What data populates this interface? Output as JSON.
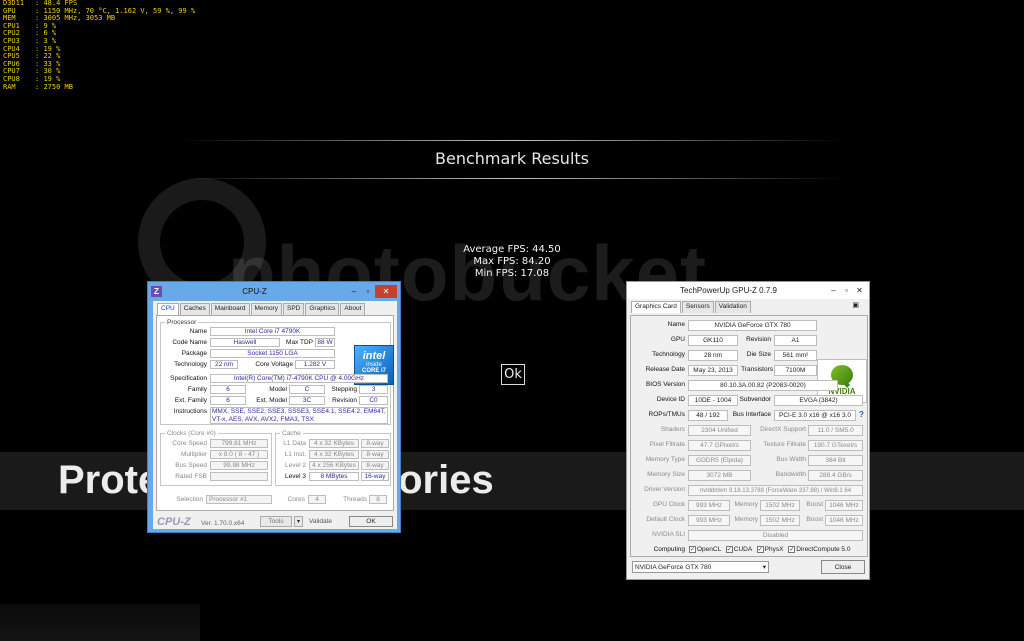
{
  "osd": {
    "lines": [
      {
        "k": "D3D11",
        "v": "48.4 FPS"
      },
      {
        "k": "GPU",
        "v": "1150 MHz, 70 °C, 1.162 V, 59 %, 99 %"
      },
      {
        "k": "MEM",
        "v": "3005 MHz, 3053 MB"
      },
      {
        "k": "CPU1",
        "v": "9 %"
      },
      {
        "k": "CPU2",
        "v": "6 %"
      },
      {
        "k": "CPU3",
        "v": "3 %"
      },
      {
        "k": "CPU4",
        "v": "19 %"
      },
      {
        "k": "CPU5",
        "v": "22 %"
      },
      {
        "k": "CPU6",
        "v": "33 %"
      },
      {
        "k": "CPU7",
        "v": "30 %"
      },
      {
        "k": "CPU8",
        "v": "19 %"
      },
      {
        "k": "RAM",
        "v": "2750 MB"
      }
    ],
    "color": "#f0d000"
  },
  "benchmark": {
    "title": "Benchmark Results",
    "average": "Average FPS: 44.50",
    "max": "Max FPS: 84.20",
    "min": "Min FPS: 17.08",
    "ok": "Ok"
  },
  "watermark": {
    "brand": "photobucket",
    "protect": "Protect your memories"
  },
  "cpuz": {
    "title": "CPU-Z",
    "tabs": [
      "CPU",
      "Caches",
      "Mainboard",
      "Memory",
      "SPD",
      "Graphics",
      "About"
    ],
    "processor_group": "Processor",
    "name_label": "Name",
    "name": "Intel Core i7 4790K",
    "codename_label": "Code Name",
    "codename": "Haswell",
    "maxtdp_label": "Max TDP",
    "maxtdp": "88 W",
    "package_label": "Package",
    "package": "Socket 1150 LGA",
    "technology_label": "Technology",
    "technology": "22 nm",
    "corevoltage_label": "Core Voltage",
    "corevoltage": "1.282 V",
    "spec_label": "Specification",
    "spec": "Intel(R) Core(TM) i7-4790K CPU @ 4.00GHz",
    "family_label": "Family",
    "family": "6",
    "model_label": "Model",
    "model": "C",
    "stepping_label": "Stepping",
    "stepping": "3",
    "extfamily_label": "Ext. Family",
    "extfamily": "6",
    "extmodel_label": "Ext. Model",
    "extmodel": "3C",
    "revision_label": "Revision",
    "revision": "C0",
    "instructions_label": "Instructions",
    "instructions": "MMX, SSE, SSE2, SSE3, SSSE3, SSE4.1, SSE4.2, EM64T, VT-x, AES, AVX, AVX2, FMA3, TSX",
    "intel_logo": {
      "brand": "intel",
      "inside": "inside",
      "core": "CORE i7"
    },
    "clocks_group": "Clocks (Core #0)",
    "corespeed_label": "Core Speed",
    "corespeed": "799.81 MHz",
    "multiplier_label": "Multiplier",
    "multiplier": "x 8.0 ( 8 - 47 )",
    "busspeed_label": "Bus Speed",
    "busspeed": "99.98 MHz",
    "ratedfsb_label": "Rated FSB",
    "ratedfsb": "",
    "cache_group": "Cache",
    "l1d_label": "L1 Data",
    "l1d": "4 x 32 KBytes",
    "l1d_way": "8-way",
    "l1i_label": "L1 Inst.",
    "l1i": "4 x 32 KBytes",
    "l1i_way": "8-way",
    "l2_label": "Level 2",
    "l2": "4 x 256 KBytes",
    "l2_way": "8-way",
    "l3_label": "Level 3",
    "l3": "8 MBytes",
    "l3_way": "16-way",
    "selection_label": "Selection",
    "selection": "Processor #1",
    "cores_label": "Cores",
    "cores": "4",
    "threads_label": "Threads",
    "threads": "8",
    "footer_logo": "CPU-Z",
    "version": "Ver. 1.70.0.x64",
    "tools": "Tools",
    "validate": "Validate",
    "ok": "OK"
  },
  "gpuz": {
    "title": "TechPowerUp GPU-Z 0.7.9",
    "tabs": [
      "Graphics Card",
      "Sensors",
      "Validation"
    ],
    "name_label": "Name",
    "name": "NVIDIA GeForce GTX 780",
    "gpu_label": "GPU",
    "gpu": "GK110",
    "revision_label": "Revision",
    "revision": "A1",
    "technology_label": "Technology",
    "technology": "28 nm",
    "diesize_label": "Die Size",
    "diesize": "561 mm²",
    "release_label": "Release Date",
    "release": "May 23, 2013",
    "transistors_label": "Transistors",
    "transistors": "7100M",
    "bios_label": "BIOS Version",
    "bios": "80.10.3A.00.82 (P2083-0020)",
    "deviceid_label": "Device ID",
    "deviceid": "10DE - 1004",
    "subvendor_label": "Subvendor",
    "subvendor": "EVGA (3842)",
    "rops_label": "ROPs/TMUs",
    "rops": "48 / 192",
    "businterface_label": "Bus Interface",
    "businterface": "PCI-E 3.0 x16 @ x16 3.0",
    "help": "?",
    "shaders_label": "Shaders",
    "shaders": "2304 Unified",
    "directx_label": "DirectX Support",
    "directx": "11.0 / SM5.0",
    "pixel_label": "Pixel Fillrate",
    "pixel": "47.7 GPixel/s",
    "texture_label": "Texture Fillrate",
    "texture": "190.7 GTexel/s",
    "memtype_label": "Memory Type",
    "memtype": "GDDR5 (Elpida)",
    "buswidth_label": "Bus Width",
    "buswidth": "384 Bit",
    "memsize_label": "Memory Size",
    "memsize": "3072 MB",
    "bandwidth_label": "Bandwidth",
    "bandwidth": "288.4 GB/s",
    "driver_label": "Driver Version",
    "driver": "nvlddmkm 9.18.13.3788 (ForceWare 337.88) / Win8.1 64",
    "gpuclock_label": "GPU Clock",
    "gpuclock": "993 MHz",
    "memory_label": "Memory",
    "memory": "1502 MHz",
    "boost_label": "Boost",
    "boost": "1046 MHz",
    "defclock_label": "Default Clock",
    "defclock": "993 MHz",
    "defmemory": "1502 MHz",
    "defboost": "1046 MHz",
    "sli_label": "NVIDIA SLI",
    "sli": "Disabled",
    "computing_label": "Computing",
    "opencl": "OpenCL",
    "cuda": "CUDA",
    "physx": "PhysX",
    "directcompute": "DirectCompute 5.0",
    "selected_card": "NVIDIA GeForce GTX 780",
    "close": "Close",
    "nvidia_logo": "NVIDIA"
  }
}
